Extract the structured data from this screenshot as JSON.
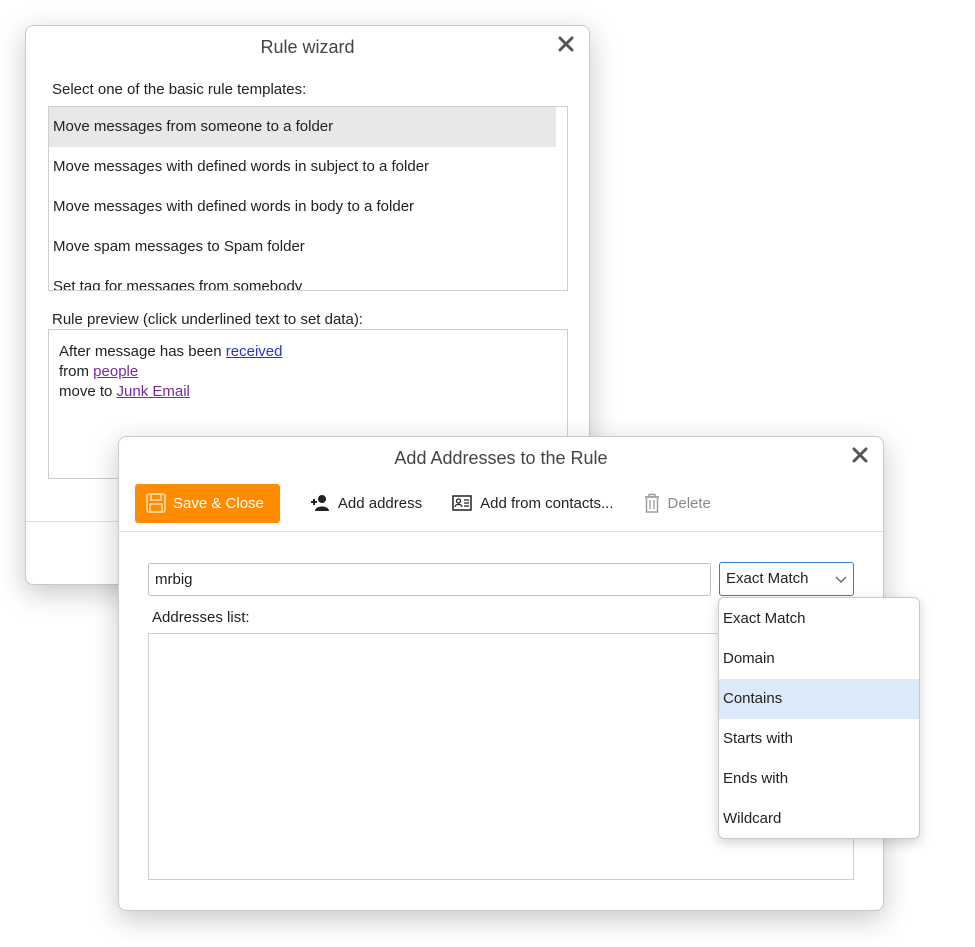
{
  "rule_wizard": {
    "title": "Rule wizard",
    "templates_label": "Select one of the basic rule templates:",
    "templates": [
      "Move messages from someone to a folder",
      "Move messages with defined words in subject to a folder",
      "Move messages with defined words in body to a folder",
      "Move spam messages to Spam folder",
      "Set tag for messages from somebody"
    ],
    "selected_template_index": 0,
    "preview_label": "Rule preview (click underlined text to set data):",
    "preview": {
      "line1_text": "After message has been ",
      "line1_link": "received",
      "line2_text": "from ",
      "line2_link": "people",
      "line3_text": "move to ",
      "line3_link": "Junk Email"
    }
  },
  "add_addresses": {
    "title": "Add Addresses to the Rule",
    "toolbar": {
      "save_label": "Save & Close",
      "add_address_label": "Add address",
      "add_contacts_label": "Add from contacts...",
      "delete_label": "Delete"
    },
    "address_input_value": "mrbig",
    "match_select_value": "Exact Match",
    "addresses_label": "Addresses list:",
    "addresses": []
  },
  "match_dropdown": {
    "options": [
      "Exact Match",
      "Domain",
      "Contains",
      "Starts with",
      "Ends with",
      "Wildcard"
    ],
    "hovered_index": 2
  },
  "colors": {
    "accent": "#ff8c00",
    "hover": "#dce9f8",
    "link": "#2a34c9",
    "visited_link": "#7b2a9a",
    "focus_border": "#2e7fd6"
  }
}
